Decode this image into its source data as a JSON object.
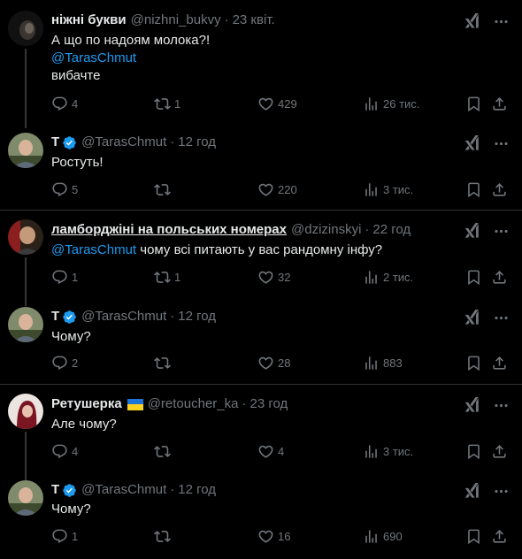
{
  "tweets": [
    {
      "name": "ніжні букви",
      "handle": "@nizhni_bukvy",
      "time": "23 квіт.",
      "line1": "А що по надоям молока?!",
      "mention": "@TarasChmut",
      "line3": "вибачте",
      "replies": "4",
      "retweets": "1",
      "likes": "429",
      "views": "26 тис."
    },
    {
      "name": "T",
      "handle": "@TarasChmut",
      "time": "12 год",
      "text": "Ростуть!",
      "replies": "5",
      "retweets": "",
      "likes": "220",
      "views": "3 тис."
    },
    {
      "name": "ламборджіні на польських номерах",
      "handle": "@dzizinskyi",
      "time": "22 год",
      "mention": "@TarasChmut",
      "text": " чому всі питають у вас рандомну інфу?",
      "replies": "1",
      "retweets": "1",
      "likes": "32",
      "views": "2 тис."
    },
    {
      "name": "T",
      "handle": "@TarasChmut",
      "time": "12 год",
      "text": "Чому?",
      "replies": "2",
      "retweets": "",
      "likes": "28",
      "views": "883"
    },
    {
      "name": "Ретушерка",
      "handle": "@retoucher_ka",
      "time": "23 год",
      "text": "Але чому?",
      "replies": "4",
      "retweets": "",
      "likes": "4",
      "views": "3 тис."
    },
    {
      "name": "T",
      "handle": "@TarasChmut",
      "time": "12 год",
      "text": "Чому?",
      "replies": "1",
      "retweets": "",
      "likes": "16",
      "views": "690"
    }
  ],
  "separator": "·",
  "colors": {
    "background": "#000000",
    "text": "#e7e9ea",
    "muted": "#71767b",
    "accent": "#1d9bf0"
  }
}
